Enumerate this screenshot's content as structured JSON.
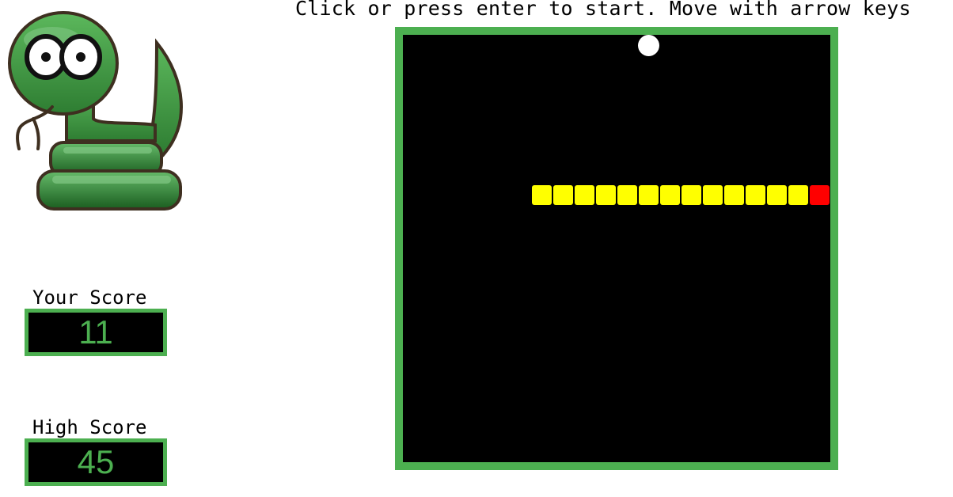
{
  "instructions": "Click or press enter to start. Move with arrow keys",
  "mascot": {
    "icon": "snake-mascot-icon"
  },
  "scores": {
    "your_label": "Your Score",
    "your_value": "11",
    "high_label": "High Score",
    "high_value": "45"
  },
  "game": {
    "grid": {
      "cols": 20,
      "rows": 20
    },
    "snake": {
      "head": [
        19,
        7
      ],
      "body": [
        [
          18,
          7
        ],
        [
          17,
          7
        ],
        [
          16,
          7
        ],
        [
          15,
          7
        ],
        [
          14,
          7
        ],
        [
          13,
          7
        ],
        [
          12,
          7
        ],
        [
          11,
          7
        ],
        [
          10,
          7
        ],
        [
          9,
          7
        ],
        [
          8,
          7
        ],
        [
          7,
          7
        ],
        [
          6,
          7
        ]
      ],
      "direction": "right"
    },
    "food": [
      11,
      0
    ],
    "colors": {
      "board_border": "#4caf50",
      "board_bg": "#000000",
      "snake_body": "#ffff00",
      "snake_head": "#ff0000",
      "food": "#ffffff",
      "score_text": "#4caf50"
    }
  }
}
